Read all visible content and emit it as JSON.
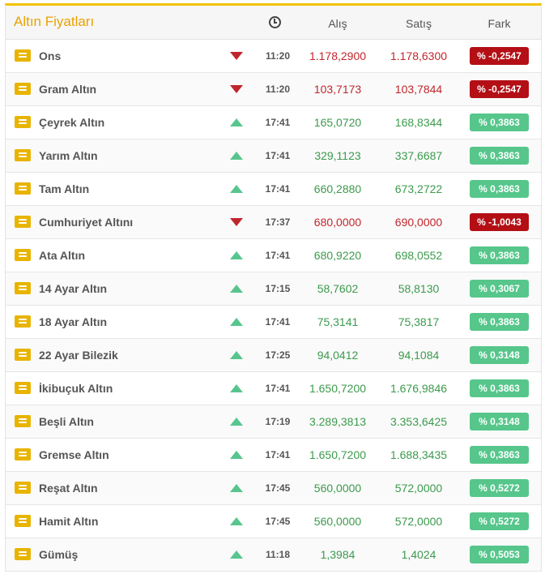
{
  "header": {
    "title": "Altın Fiyatları",
    "time_icon": "clock-icon",
    "buy": "Alış",
    "sell": "Satış",
    "diff": "Fark"
  },
  "colors": {
    "accent": "#f2c200",
    "down": "#c0262d",
    "up": "#58c58e"
  },
  "rows": [
    {
      "name": "Ons",
      "trend": "down",
      "time": "11:20",
      "buy": "1.178,2900",
      "sell": "1.178,6300",
      "diff": "% -0,2547"
    },
    {
      "name": "Gram Altın",
      "trend": "down",
      "time": "11:20",
      "buy": "103,7173",
      "sell": "103,7844",
      "diff": "% -0,2547"
    },
    {
      "name": "Çeyrek Altın",
      "trend": "up",
      "time": "17:41",
      "buy": "165,0720",
      "sell": "168,8344",
      "diff": "% 0,3863"
    },
    {
      "name": "Yarım Altın",
      "trend": "up",
      "time": "17:41",
      "buy": "329,1123",
      "sell": "337,6687",
      "diff": "% 0,3863"
    },
    {
      "name": "Tam Altın",
      "trend": "up",
      "time": "17:41",
      "buy": "660,2880",
      "sell": "673,2722",
      "diff": "% 0,3863"
    },
    {
      "name": "Cumhuriyet Altını",
      "trend": "down",
      "time": "17:37",
      "buy": "680,0000",
      "sell": "690,0000",
      "diff": "% -1,0043"
    },
    {
      "name": "Ata Altın",
      "trend": "up",
      "time": "17:41",
      "buy": "680,9220",
      "sell": "698,0552",
      "diff": "% 0,3863"
    },
    {
      "name": "14 Ayar Altın",
      "trend": "up",
      "time": "17:15",
      "buy": "58,7602",
      "sell": "58,8130",
      "diff": "% 0,3067"
    },
    {
      "name": "18 Ayar Altın",
      "trend": "up",
      "time": "17:41",
      "buy": "75,3141",
      "sell": "75,3817",
      "diff": "% 0,3863"
    },
    {
      "name": "22 Ayar Bilezik",
      "trend": "up",
      "time": "17:25",
      "buy": "94,0412",
      "sell": "94,1084",
      "diff": "% 0,3148"
    },
    {
      "name": "İkibuçuk Altın",
      "trend": "up",
      "time": "17:41",
      "buy": "1.650,7200",
      "sell": "1.676,9846",
      "diff": "% 0,3863"
    },
    {
      "name": "Beşli Altın",
      "trend": "up",
      "time": "17:19",
      "buy": "3.289,3813",
      "sell": "3.353,6425",
      "diff": "% 0,3148"
    },
    {
      "name": "Gremse Altın",
      "trend": "up",
      "time": "17:41",
      "buy": "1.650,7200",
      "sell": "1.688,3435",
      "diff": "% 0,3863"
    },
    {
      "name": "Reşat Altın",
      "trend": "up",
      "time": "17:45",
      "buy": "560,0000",
      "sell": "572,0000",
      "diff": "% 0,5272"
    },
    {
      "name": "Hamit Altın",
      "trend": "up",
      "time": "17:45",
      "buy": "560,0000",
      "sell": "572,0000",
      "diff": "% 0,5272"
    },
    {
      "name": "Gümüş",
      "trend": "up",
      "time": "11:18",
      "buy": "1,3984",
      "sell": "1,4024",
      "diff": "% 0,5053"
    }
  ]
}
